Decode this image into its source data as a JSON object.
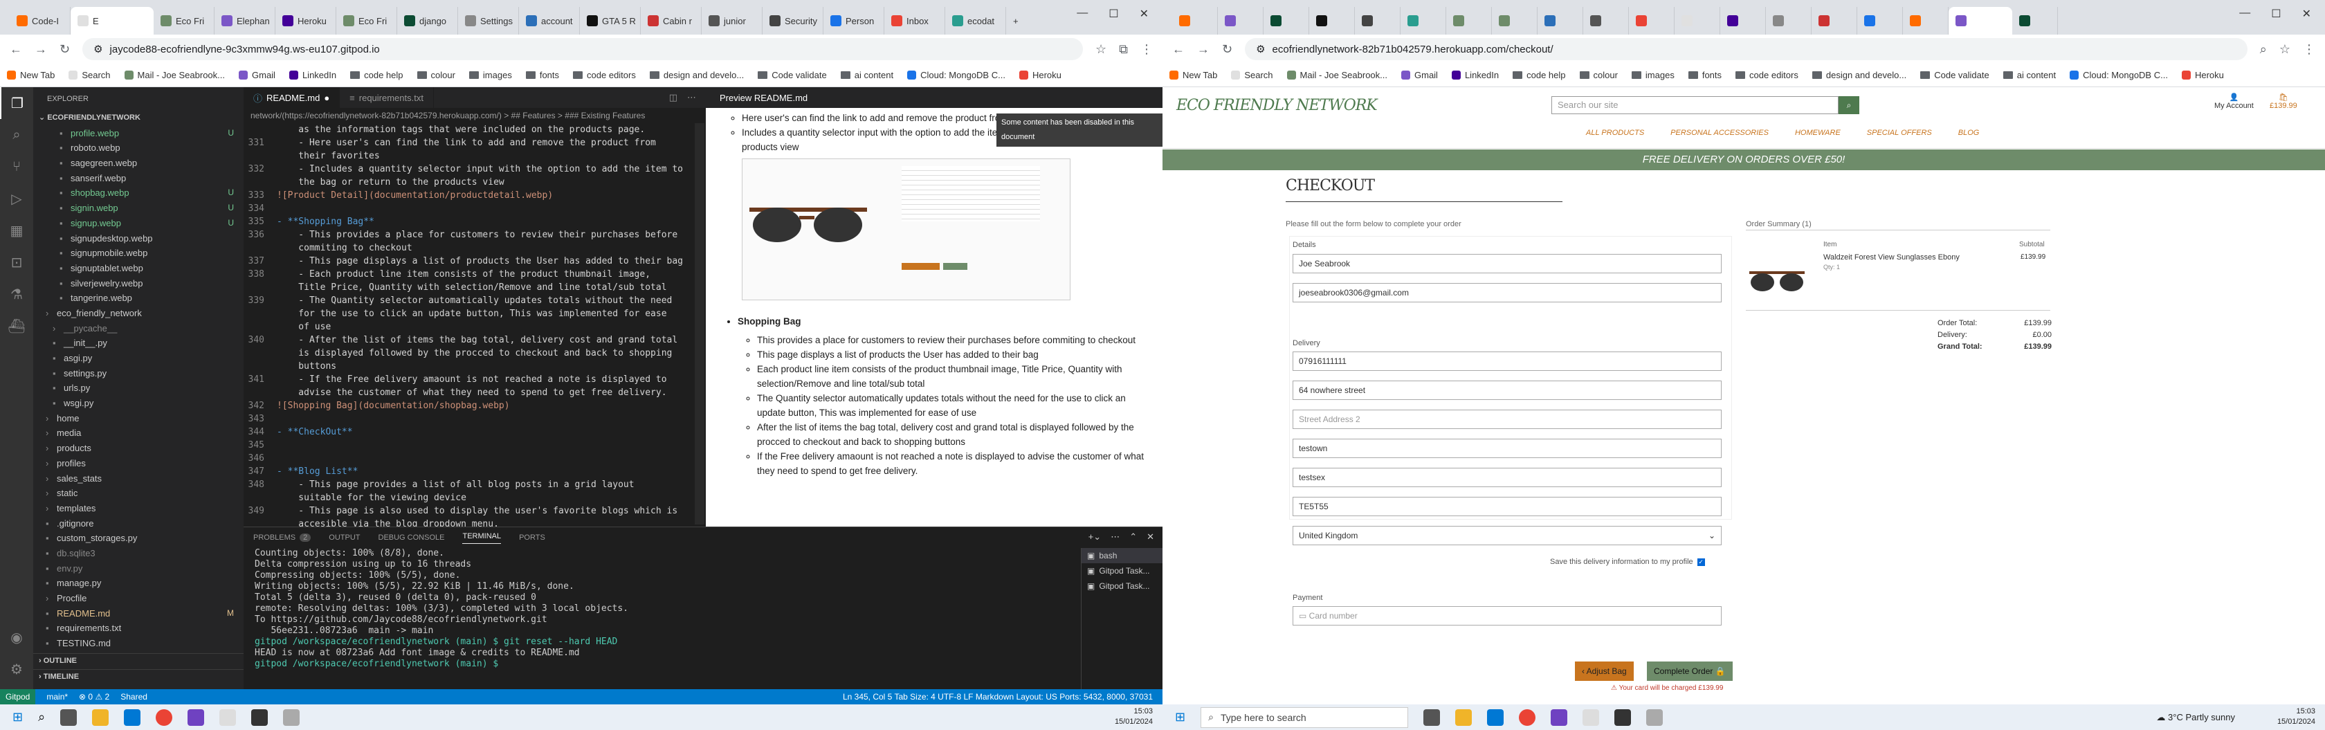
{
  "left_browser": {
    "tabs": [
      "Code-I",
      "E",
      "Eco Fri",
      "Elephan",
      "Heroku",
      "Eco Fri",
      "django",
      "Settings",
      "account",
      "GTA 5 R",
      "Cabin r",
      "junior",
      "Security",
      "Person",
      "Inbox",
      "ecodat"
    ],
    "url": "jaycode88-ecofriendlyne-9c3xmmw94g.ws-eu107.gitpod.io",
    "bookmarks": [
      "New Tab",
      "Search",
      "Mail - Joe Seabrook...",
      "Gmail",
      "LinkedIn",
      "code help",
      "colour",
      "images",
      "fonts",
      "code editors",
      "design and develo...",
      "Code validate",
      "ai content",
      "Cloud: MongoDB C...",
      "Heroku"
    ]
  },
  "vscode": {
    "explorer_title": "EXPLORER",
    "workspace": "ECOFRIENDLYNETWORK",
    "tree": [
      {
        "label": "profile.webp",
        "badge": "U",
        "color": "#73c991",
        "indent": 3
      },
      {
        "label": "roboto.webp",
        "badge": "",
        "color": "#ccc",
        "indent": 3
      },
      {
        "label": "sagegreen.webp",
        "badge": "",
        "color": "#ccc",
        "indent": 3
      },
      {
        "label": "sanserif.webp",
        "badge": "",
        "color": "#ccc",
        "indent": 3
      },
      {
        "label": "shopbag.webp",
        "badge": "U",
        "color": "#73c991",
        "indent": 3
      },
      {
        "label": "signin.webp",
        "badge": "U",
        "color": "#73c991",
        "indent": 3
      },
      {
        "label": "signup.webp",
        "badge": "U",
        "color": "#73c991",
        "indent": 3
      },
      {
        "label": "signupdesktop.webp",
        "badge": "",
        "color": "#ccc",
        "indent": 3
      },
      {
        "label": "signupmobile.webp",
        "badge": "",
        "color": "#ccc",
        "indent": 3
      },
      {
        "label": "signuptablet.webp",
        "badge": "",
        "color": "#ccc",
        "indent": 3
      },
      {
        "label": "silverjewelry.webp",
        "badge": "",
        "color": "#ccc",
        "indent": 3
      },
      {
        "label": "tangerine.webp",
        "badge": "",
        "color": "#ccc",
        "indent": 3
      },
      {
        "label": "eco_friendly_network",
        "badge": "",
        "color": "#ccc",
        "indent": 1
      },
      {
        "label": "__pycache__",
        "badge": "",
        "color": "#888",
        "indent": 2
      },
      {
        "label": "__init__.py",
        "badge": "",
        "color": "#ccc",
        "indent": 2
      },
      {
        "label": "asgi.py",
        "badge": "",
        "color": "#ccc",
        "indent": 2
      },
      {
        "label": "settings.py",
        "badge": "",
        "color": "#ccc",
        "indent": 2
      },
      {
        "label": "urls.py",
        "badge": "",
        "color": "#ccc",
        "indent": 2
      },
      {
        "label": "wsgi.py",
        "badge": "",
        "color": "#ccc",
        "indent": 2
      },
      {
        "label": "home",
        "badge": "",
        "color": "#ccc",
        "indent": 1
      },
      {
        "label": "media",
        "badge": "",
        "color": "#ccc",
        "indent": 1
      },
      {
        "label": "products",
        "badge": "",
        "color": "#ccc",
        "indent": 1
      },
      {
        "label": "profiles",
        "badge": "",
        "color": "#ccc",
        "indent": 1
      },
      {
        "label": "sales_stats",
        "badge": "",
        "color": "#ccc",
        "indent": 1
      },
      {
        "label": "static",
        "badge": "",
        "color": "#ccc",
        "indent": 1
      },
      {
        "label": "templates",
        "badge": "",
        "color": "#ccc",
        "indent": 1
      },
      {
        "label": ".gitignore",
        "badge": "",
        "color": "#ccc",
        "indent": 1
      },
      {
        "label": "custom_storages.py",
        "badge": "",
        "color": "#ccc",
        "indent": 1
      },
      {
        "label": "db.sqlite3",
        "badge": "",
        "color": "#888",
        "indent": 1
      },
      {
        "label": "env.py",
        "badge": "",
        "color": "#888",
        "indent": 1
      },
      {
        "label": "manage.py",
        "badge": "",
        "color": "#ccc",
        "indent": 1
      },
      {
        "label": "Procfile",
        "badge": "",
        "color": "#ccc",
        "indent": 1
      },
      {
        "label": "README.md",
        "badge": "M",
        "color": "#e2c08d",
        "indent": 1
      },
      {
        "label": "requirements.txt",
        "badge": "",
        "color": "#ccc",
        "indent": 1
      },
      {
        "label": "TESTING.md",
        "badge": "",
        "color": "#ccc",
        "indent": 1
      }
    ],
    "outline": "OUTLINE",
    "timeline": "TIMELINE",
    "editor_tabs": [
      "README.md",
      "requirements.txt"
    ],
    "breadcrumb": "network/(https://ecofriendlynetwork-82b71b042579.herokuapp.com/) > ## Features > ### Existing Features",
    "code_lines": [
      {
        "n": "",
        "t": "    as the information tags that were included on the products page."
      },
      {
        "n": "331",
        "t": "    - Here user's can find the link to add and remove the product from"
      },
      {
        "n": "",
        "t": "    their favorites"
      },
      {
        "n": "332",
        "t": "    - Includes a quantity selector input with the option to add the item to"
      },
      {
        "n": "",
        "t": "    the bag or return to the products view"
      },
      {
        "n": "333",
        "t": "![Product Detail](documentation/productdetail.webp)"
      },
      {
        "n": "334",
        "t": ""
      },
      {
        "n": "335",
        "t": "- **Shopping Bag**"
      },
      {
        "n": "336",
        "t": "    - This provides a place for customers to review their purchases before"
      },
      {
        "n": "",
        "t": "    commiting to checkout"
      },
      {
        "n": "337",
        "t": "    - This page displays a list of products the User has added to their bag"
      },
      {
        "n": "338",
        "t": "    - Each product line item consists of the product thumbnail image,"
      },
      {
        "n": "",
        "t": "    Title Price, Quantity with selection/Remove and line total/sub total"
      },
      {
        "n": "339",
        "t": "    - The Quantity selector automatically updates totals without the need"
      },
      {
        "n": "",
        "t": "    for the use to click an update button, This was implemented for ease"
      },
      {
        "n": "",
        "t": "    of use"
      },
      {
        "n": "340",
        "t": "    - After the list of items the bag total, delivery cost and grand total"
      },
      {
        "n": "",
        "t": "    is displayed followed by the procced to checkout and back to shopping"
      },
      {
        "n": "",
        "t": "    buttons"
      },
      {
        "n": "341",
        "t": "    - If the Free delivery amaount is not reached a note is displayed to"
      },
      {
        "n": "",
        "t": "    advise the customer of what they need to spend to get free delivery."
      },
      {
        "n": "342",
        "t": "![Shopping Bag](documentation/shopbag.webp)"
      },
      {
        "n": "343",
        "t": ""
      },
      {
        "n": "344",
        "t": "- **CheckOut**"
      },
      {
        "n": "345",
        "t": ""
      },
      {
        "n": "346",
        "t": ""
      },
      {
        "n": "347",
        "t": "- **Blog List**"
      },
      {
        "n": "348",
        "t": "    - This page provides a list of all blog posts in a grid layout"
      },
      {
        "n": "",
        "t": "    suitable for the viewing device"
      },
      {
        "n": "349",
        "t": "    - This page is also used to display the user's favorite blogs which is"
      },
      {
        "n": "",
        "t": "    accesible via the blog dropdown menu."
      }
    ],
    "preview_tab": "Preview README.md",
    "preview_bullets_top": [
      "Here user's can find the link to add and remove the product from their favorites",
      "Includes a quantity selector input with the option to add the item to the bag or return to the products view"
    ],
    "preview_tooltip": "Some content has been disabled in this document",
    "preview_heading": "Shopping Bag",
    "preview_bullets": [
      "This provides a place for customers to review their purchases before commiting to checkout",
      "This page displays a list of products the User has added to their bag",
      "Each product line item consists of the product thumbnail image, Title Price, Quantity with selection/Remove and line total/sub total",
      "The Quantity selector automatically updates totals without the need for the use to click an update button, This was implemented for ease of use",
      "After the list of items the bag total, delivery cost and grand total is displayed followed by the procced to checkout and back to shopping buttons",
      "If the Free delivery amaount is not reached a note is displayed to advise the customer of what they need to spend to get free delivery."
    ],
    "panel_tabs": [
      "PROBLEMS",
      "OUTPUT",
      "DEBUG CONSOLE",
      "TERMINAL",
      "PORTS"
    ],
    "problems_count": "2",
    "terminal_lines": [
      "Counting objects: 100% (8/8), done.",
      "Delta compression using up to 16 threads",
      "Compressing objects: 100% (5/5), done.",
      "Writing objects: 100% (5/5), 22.92 KiB | 11.46 MiB/s, done.",
      "Total 5 (delta 3), reused 0 (delta 0), pack-reused 0",
      "remote: Resolving deltas: 100% (3/3), completed with 3 local objects.",
      "To https://github.com/Jaycode88/ecofriendlynetwork.git",
      "   56ee231..08723a6  main -> main",
      "gitpod /workspace/ecofriendlynetwork (main) $ git reset --hard HEAD",
      "HEAD is now at 08723a6 Add font image & credits to README.md",
      "gitpod /workspace/ecofriendlynetwork (main) $ "
    ],
    "terminal_list": [
      "bash",
      "Gitpod Task...",
      "Gitpod Task..."
    ],
    "status_left": [
      "Gitpod",
      "main*",
      "⊗ 0 ⚠ 2",
      "Shared"
    ],
    "status_right": "Ln 345, Col 5   Tab Size: 4   UTF-8   LF   Markdown   Layout: US   Ports: 5432, 8000, 37031"
  },
  "left_clock": {
    "time": "15:03",
    "date": "15/01/2024"
  },
  "right_browser": {
    "url": "ecofriendlynetwork-82b71b042579.herokuapp.com/checkout/",
    "bookmarks": [
      "New Tab",
      "Search",
      "Mail - Joe Seabrook...",
      "Gmail",
      "LinkedIn",
      "code help",
      "colour",
      "images",
      "fonts",
      "code editors",
      "design and develo...",
      "Code validate",
      "ai content",
      "Cloud: MongoDB C...",
      "Heroku"
    ]
  },
  "site": {
    "logo": "ECO FRIENDLY NETWORK",
    "search_placeholder": "Search our site",
    "account": "My Account",
    "bag_total": "£139.99",
    "nav": [
      "ALL PRODUCTS",
      "PERSONAL ACCESSORIES",
      "HOMEWARE",
      "SPECIAL OFFERS",
      "BLOG"
    ],
    "banner": "FREE DELIVERY ON ORDERS OVER £50!",
    "heading": "CHECKOUT",
    "intro": "Please fill out the form below to complete your order",
    "details_label": "Details",
    "full_name": "Joe Seabrook",
    "email": "joeseabrook0306@gmail.com",
    "delivery_label": "Delivery",
    "phone": "07916111111",
    "street1": "64 nowhere street",
    "street2_placeholder": "Street Address 2",
    "town": "testown",
    "county": "testsex",
    "postcode": "TE5T55",
    "country": "United Kingdom",
    "save_info": "Save this delivery information to my profile",
    "payment_label": "Payment",
    "card_placeholder": "Card number",
    "adjust_bag": "Adjust Bag",
    "complete_order": "Complete Order",
    "charge_note": "Your card will be charged £139.99",
    "summary_title": "Order Summary (1)",
    "col_item": "Item",
    "col_subtotal": "Subtotal",
    "product_name": "Waldzeit Forest View Sunglasses Ebony",
    "qty": "Qty: 1",
    "line_subtotal": "£139.99",
    "order_total_label": "Order Total:",
    "order_total": "£139.99",
    "delivery_cost_label": "Delivery:",
    "delivery_cost": "£0.00",
    "grand_total_label": "Grand Total:",
    "grand_total": "£139.99"
  },
  "right_taskbar": {
    "search": "Type here to search",
    "weather": "3°C  Partly sunny",
    "time": "15:03",
    "date": "15/01/2024"
  },
  "colors": {
    "vscode_blue": "#007acc",
    "site_green": "#6e8c6a",
    "accent_orange": "#c8741e"
  }
}
